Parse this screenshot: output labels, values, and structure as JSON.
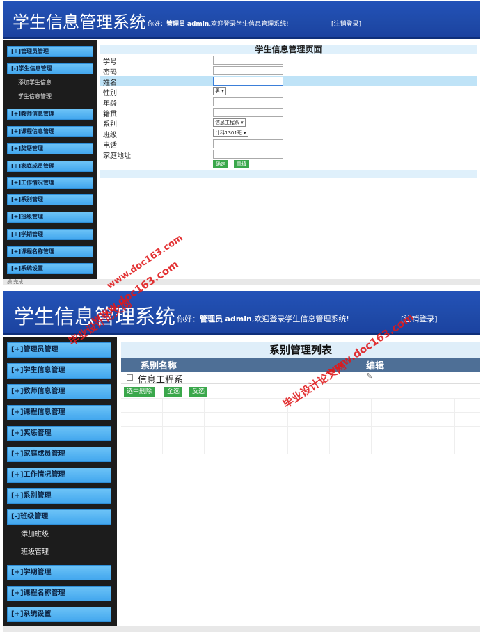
{
  "shot1": {
    "app_title": "学生信息管理系统",
    "welcome_prefix": "你好：",
    "role": "管理员",
    "user": "admin",
    "welcome_suffix": ",欢迎登录学生信息管理系统!",
    "logout": "[注销登录]",
    "sidebar": [
      "[+]管理员管理",
      "[-]学生信息管理",
      "[+]教师信息管理",
      "[+]课程信息管理",
      "[+]奖惩管理",
      "[+]家庭成员管理",
      "[+]工作情况管理",
      "[+]系别管理",
      "[+]班级管理",
      "[+]学期管理",
      "[+]课程名称管理",
      "[+]系统设置"
    ],
    "sub_items": [
      "添加学生信息",
      "学生信息管理"
    ],
    "page_title": "学生信息管理页面",
    "fields": [
      {
        "label": "学号"
      },
      {
        "label": "密码"
      },
      {
        "label": "姓名"
      },
      {
        "label": "性别",
        "select": "男"
      },
      {
        "label": "年龄"
      },
      {
        "label": "籍贯"
      },
      {
        "label": "系别",
        "select": "信息工程系"
      },
      {
        "label": "班级",
        "select": "计科1301班"
      },
      {
        "label": "电话"
      },
      {
        "label": "家庭地址"
      }
    ],
    "confirm_label": "确定",
    "reset_label": "重填",
    "status_text": "操 完成"
  },
  "shot2": {
    "app_title": "学生信息管理系统",
    "welcome_prefix": "你好：",
    "role": "管理员",
    "user": "admin",
    "welcome_suffix": ",欢迎登录学生信息管理系统!",
    "logout": "[注销登录]",
    "sidebar": [
      "[+]管理员管理",
      "[+]学生信息管理",
      "[+]教师信息管理",
      "[+]课程信息管理",
      "[+]奖惩管理",
      "[+]家庭成员管理",
      "[+]工作情况管理",
      "[+]系别管理",
      "[-]班级管理",
      "[+]学期管理",
      "[+]课程名称管理",
      "[+]系统设置"
    ],
    "sub_items": [
      "添加班级",
      "班级管理"
    ],
    "page_title": "系别管理列表",
    "col_name": "系别名称",
    "col_edit": "编辑",
    "rows": [
      "信息工程系"
    ],
    "btn_delete": "选中删除",
    "btn_select_all": "全选",
    "btn_invert": "反选"
  },
  "watermarks": [
    "毕业设计论文网",
    "www.doc163.com"
  ],
  "colors": {
    "header": "#1f4aa8",
    "menu": "#43a7ee",
    "button": "#3aa74b",
    "sidebar": "#1c1c1c"
  }
}
